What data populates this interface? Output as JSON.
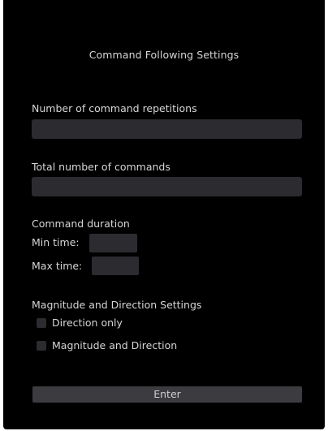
{
  "settings": {
    "title": "Command Following Settings",
    "repetitions_label": "Number of command repetitions",
    "repetitions_value": "",
    "total_label": "Total number of commands",
    "total_value": "",
    "duration_label": "Command duration",
    "min_time_label": "Min time:",
    "min_time_value": "",
    "max_time_label": "Max time:",
    "max_time_value": "",
    "magnitude_section_label": "Magnitude and Direction Settings",
    "option_direction_only": "Direction only",
    "option_magnitude_and_direction": "Magnitude and Direction",
    "enter_label": "Enter"
  },
  "colors": {
    "background": "#000000",
    "text": "#d6d6d6",
    "field": "#2b2b30",
    "button": "#3c3c40"
  }
}
